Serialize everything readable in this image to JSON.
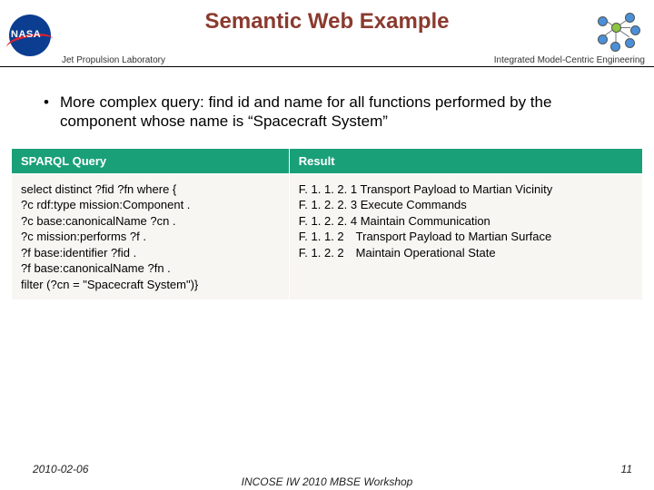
{
  "title": "Semantic Web Example",
  "header": {
    "left": "Jet Propulsion Laboratory",
    "right": "Integrated Model-Centric Engineering",
    "nasa": "NASA"
  },
  "bullet": {
    "text": "More complex query: find id and name for all functions performed by the component whose name is “Spacecraft System”"
  },
  "table": {
    "headers": {
      "col1": "SPARQL Query",
      "col2": "Result"
    },
    "query_lines": [
      "select distinct ?fid ?fn where {",
      "?c rdf:type mission:Component .",
      "?c base:canonicalName ?cn .",
      "?c mission:performs ?f .",
      "?f base:identifier ?fid .",
      "?f base:canonicalName ?fn .",
      "filter (?cn = \"Spacecraft System\")}"
    ],
    "result_lines": [
      "F. 1. 1. 2. 1 Transport Payload to Martian Vicinity",
      "F. 1. 2. 2. 3 Execute Commands",
      "F. 1. 2. 2. 4 Maintain Communication",
      "F. 1. 1. 2 Transport Payload to Martian Surface",
      "F. 1. 2. 2 Maintain Operational State"
    ]
  },
  "footer": {
    "date": "2010-02-06",
    "center": "INCOSE IW 2010 MBSE Workshop",
    "page": "11"
  }
}
